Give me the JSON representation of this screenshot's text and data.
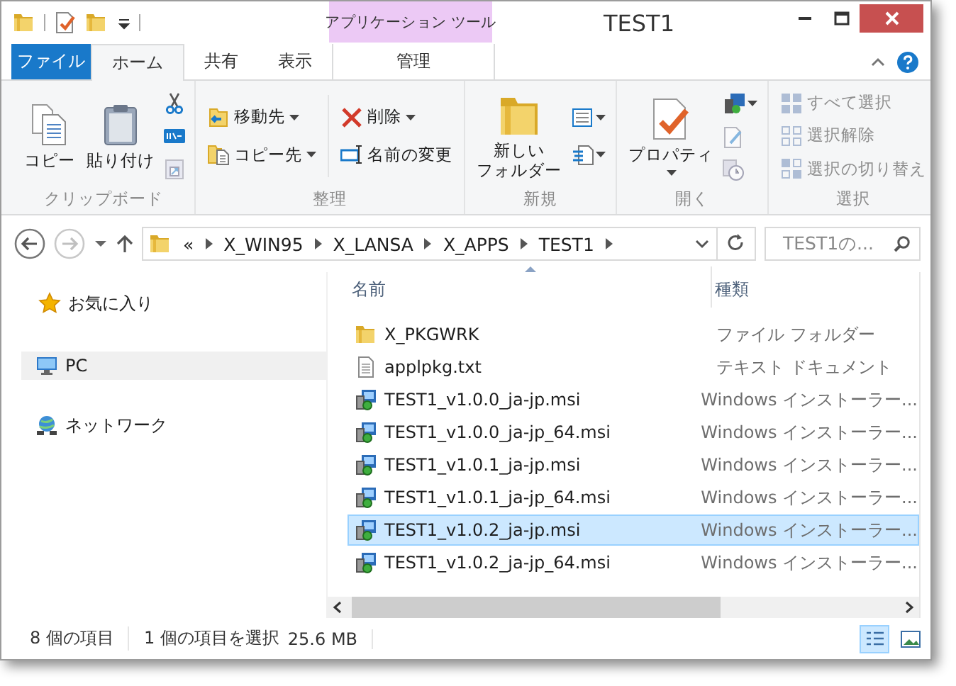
{
  "window": {
    "title": "TEST1",
    "contextual_header": "アプリケーション ツール"
  },
  "ribbon_tabs": [
    {
      "label": "ファイル",
      "kind": "file",
      "selected": false
    },
    {
      "label": "ホーム",
      "kind": "tab",
      "selected": true
    },
    {
      "label": "共有",
      "kind": "tab",
      "selected": false
    },
    {
      "label": "表示",
      "kind": "tab",
      "selected": false
    },
    {
      "label": "管理",
      "kind": "contextual",
      "selected": false
    }
  ],
  "ribbon_groups": [
    {
      "label": "クリップボード",
      "columns": [
        [
          {
            "label": "コピー",
            "kind": "large",
            "dropdown": false,
            "disabled": false
          }
        ],
        [
          {
            "label": "貼り付け",
            "kind": "large",
            "dropdown": false,
            "disabled": false
          }
        ],
        [
          {
            "kind": "icon",
            "dropdown": false,
            "disabled": false
          },
          {
            "kind": "icon",
            "dropdown": false,
            "disabled": false
          },
          {
            "kind": "icon",
            "dropdown": false,
            "disabled": true
          }
        ]
      ]
    },
    {
      "label": "整理",
      "columns": [
        [
          {
            "label": "移動先",
            "kind": "small",
            "dropdown": true,
            "disabled": false
          },
          {
            "label": "コピー先",
            "kind": "small",
            "dropdown": true,
            "disabled": false
          }
        ],
        [
          {
            "label": "削除",
            "kind": "small",
            "dropdown": true,
            "disabled": false
          },
          {
            "label": "名前の変更",
            "kind": "small",
            "dropdown": false,
            "disabled": false
          }
        ]
      ]
    },
    {
      "label": "新規",
      "columns": [
        [
          {
            "label_lines": [
              "新しい",
              "フォルダー"
            ],
            "kind": "large",
            "dropdown": false,
            "disabled": false
          }
        ],
        [
          {
            "kind": "icon",
            "dropdown": true,
            "disabled": false
          },
          {
            "kind": "icon",
            "dropdown": true,
            "disabled": false
          }
        ]
      ]
    },
    {
      "label": "開く",
      "columns": [
        [
          {
            "label": "プロパティ",
            "kind": "large",
            "dropdown": true,
            "disabled": false
          }
        ],
        [
          {
            "kind": "icon",
            "dropdown": true,
            "disabled": false
          },
          {
            "kind": "icon",
            "dropdown": false,
            "disabled": true
          },
          {
            "kind": "icon",
            "dropdown": false,
            "disabled": true
          }
        ]
      ]
    },
    {
      "label": "選択",
      "columns": [
        [
          {
            "label": "すべて選択",
            "kind": "small",
            "dropdown": false,
            "disabled": true
          },
          {
            "label": "選択解除",
            "kind": "small",
            "dropdown": false,
            "disabled": true
          },
          {
            "label": "選択の切り替え",
            "kind": "small",
            "dropdown": false,
            "disabled": true
          }
        ]
      ]
    }
  ],
  "address": {
    "overflow": "«",
    "breadcrumbs": [
      "X_WIN95",
      "X_LANSA",
      "X_APPS",
      "TEST1"
    ],
    "search_placeholder": "TEST1の..."
  },
  "navigation": [
    {
      "label": "お気に入り",
      "kind": "favorites",
      "selected": false
    },
    {
      "label": "PC",
      "kind": "pc",
      "selected": true
    },
    {
      "label": "ネットワーク",
      "kind": "network",
      "selected": false
    }
  ],
  "columns": [
    {
      "label": "名前",
      "sorted": true
    },
    {
      "label": "種類",
      "sorted": false
    }
  ],
  "files": [
    {
      "name": "X_PKGWRK",
      "type": "ファイル フォルダー",
      "kind": "folder",
      "selected": false
    },
    {
      "name": "applpkg.txt",
      "type": "テキスト ドキュメント",
      "kind": "text",
      "selected": false
    },
    {
      "name": "TEST1_v1.0.0_ja-jp.msi",
      "type": "Windows インストーラー...",
      "kind": "msi",
      "selected": false
    },
    {
      "name": "TEST1_v1.0.0_ja-jp_64.msi",
      "type": "Windows インストーラー...",
      "kind": "msi",
      "selected": false
    },
    {
      "name": "TEST1_v1.0.1_ja-jp.msi",
      "type": "Windows インストーラー...",
      "kind": "msi",
      "selected": false
    },
    {
      "name": "TEST1_v1.0.1_ja-jp_64.msi",
      "type": "Windows インストーラー...",
      "kind": "msi",
      "selected": false
    },
    {
      "name": "TEST1_v1.0.2_ja-jp.msi",
      "type": "Windows インストーラー...",
      "kind": "msi",
      "selected": true
    },
    {
      "name": "TEST1_v1.0.2_ja-jp_64.msi",
      "type": "Windows インストーラー...",
      "kind": "msi",
      "selected": false
    }
  ],
  "status_bar": {
    "item_count": "8 個の項目",
    "selection": "1 個の項目を選択",
    "size": "25.6 MB"
  },
  "view_buttons": [
    {
      "kind": "details",
      "selected": true
    },
    {
      "kind": "large-icons",
      "selected": false
    }
  ]
}
